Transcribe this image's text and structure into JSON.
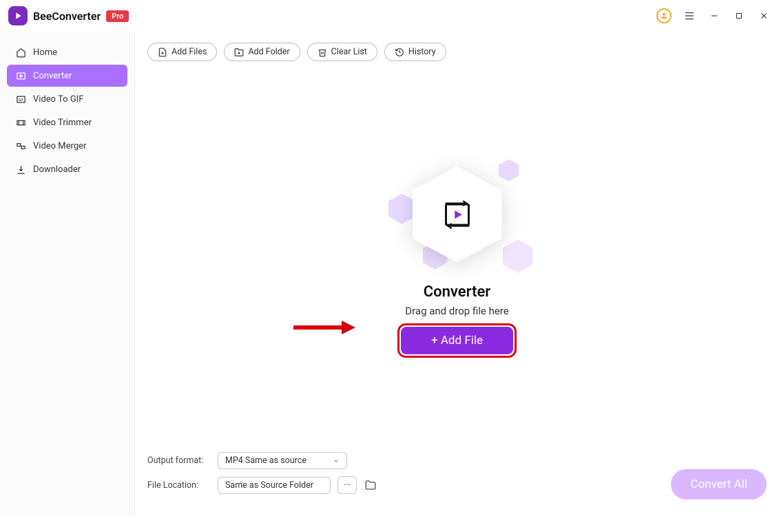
{
  "titlebar": {
    "app_name": "BeeConverter",
    "badge": "Pro"
  },
  "sidebar": {
    "items": [
      {
        "label": "Home"
      },
      {
        "label": "Converter"
      },
      {
        "label": "Video To GIF"
      },
      {
        "label": "Video Trimmer"
      },
      {
        "label": "Video Merger"
      },
      {
        "label": "Downloader"
      }
    ]
  },
  "toolbar": {
    "add_files_label": "Add Files",
    "add_folder_label": "Add Folder",
    "clear_list_label": "Clear List",
    "history_label": "History"
  },
  "drop": {
    "title": "Converter",
    "subtitle": "Drag and drop file here",
    "add_button": "+ Add File"
  },
  "footer": {
    "output_format_label": "Output format:",
    "output_format_value": "MP4 Same as source",
    "file_location_label": "File Location:",
    "file_location_value": "Same as Source Folder",
    "more": "···"
  },
  "convert_all_label": "Convert All"
}
